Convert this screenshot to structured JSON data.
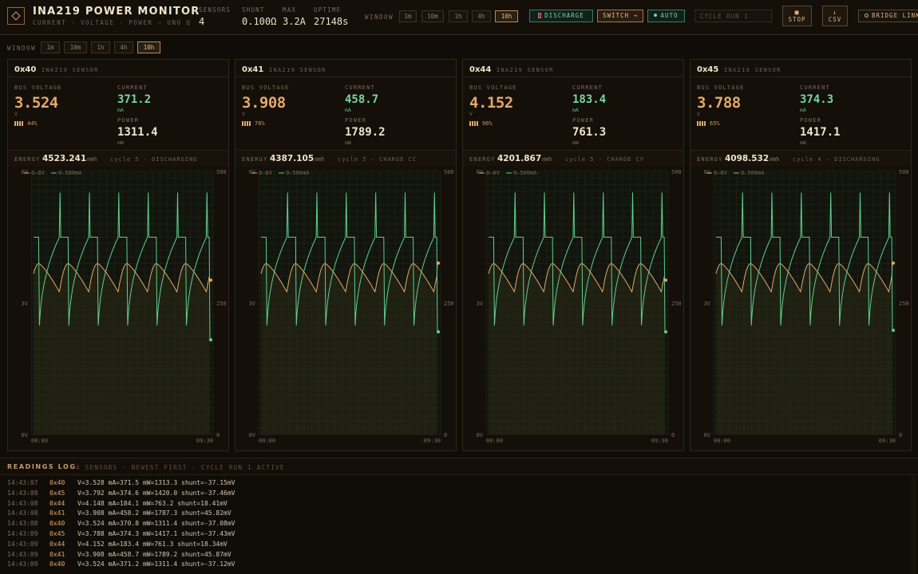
{
  "header": {
    "title": "INA219 POWER MONITOR",
    "subtitle": "CURRENT · VOLTAGE · POWER — UNO Q",
    "stats": [
      {
        "label": "SENSORS",
        "value": "4"
      },
      {
        "label": "SHUNT",
        "value": "0.100Ω"
      },
      {
        "label": "MAX",
        "value": "3.2A"
      },
      {
        "label": "UPTIME",
        "value": "27148s"
      }
    ],
    "window_label": "WINDOW",
    "windows": [
      "1m",
      "10m",
      "1h",
      "4h",
      "10h"
    ],
    "active_window": "10h",
    "discharge_label": "DISCHARGE",
    "switch_label": "SWITCH →",
    "auto_label": "AUTO",
    "cycle_placeholder": "CYCLE RUN 1",
    "stop_glyph": "■",
    "stop_label": "STOP",
    "csv_glyph": "↓",
    "csv_label": "CSV",
    "bridge_label": "BRIDGE LINK"
  },
  "subbar": {
    "window_label": "WINDOW",
    "windows": [
      "1m",
      "10m",
      "1h",
      "4h",
      "10h"
    ],
    "active_window": "10h"
  },
  "labels": {
    "bus_voltage": "BUS VOLTAGE",
    "current": "CURRENT",
    "power": "POWER",
    "unit_v": "V",
    "unit_ma": "mA",
    "unit_mw": "mW",
    "energy": "ENERGY",
    "energy_unit": "mWh",
    "sensor_type": "INA219 SENSOR",
    "legend_v": "0–6V",
    "legend_i": "0–500mA",
    "y_left": [
      "6V",
      "3V",
      "0V"
    ],
    "y_right": [
      "500",
      "250",
      "0"
    ],
    "x_ticks": [
      "00:00",
      "09:30"
    ]
  },
  "colors": {
    "voltage": "#e3a86a",
    "current": "#5fcf8f",
    "grid": "#1f2a1d"
  },
  "sensors": [
    {
      "address": "0x40",
      "voltage": "3.524",
      "current": "371.2",
      "power": "1311.4",
      "battery_pct": "44%",
      "battery_level": 0.44,
      "energy": "4523.241",
      "cycle": "cycle 5 · DISCHARGING"
    },
    {
      "address": "0x41",
      "voltage": "3.908",
      "current": "458.7",
      "power": "1789.2",
      "battery_pct": "76%",
      "battery_level": 0.76,
      "energy": "4387.105",
      "cycle": "cycle 5 · CHARGE CC"
    },
    {
      "address": "0x44",
      "voltage": "4.152",
      "current": "183.4",
      "power": "761.3",
      "battery_pct": "96%",
      "battery_level": 0.96,
      "energy": "4201.867",
      "cycle": "cycle 5 · CHARGE CV"
    },
    {
      "address": "0x45",
      "voltage": "3.788",
      "current": "374.3",
      "power": "1417.1",
      "battery_pct": "65%",
      "battery_level": 0.65,
      "energy": "4098.532",
      "cycle": "cycle 4 · DISCHARGING"
    }
  ],
  "chart_data": [
    {
      "type": "line",
      "sensor": "0x40",
      "x_range": [
        "00:00",
        "09:30"
      ],
      "voltage_range_v": [
        0,
        6
      ],
      "current_range_ma": [
        0,
        500
      ],
      "cycles": 6,
      "voltage_last": 3.52,
      "current_last": 180,
      "current_peak": 460,
      "current_plateau": 375,
      "voltage_peak": 3.9,
      "voltage_trough": 3.25,
      "current_trough": 140
    },
    {
      "type": "line",
      "sensor": "0x41",
      "x_range": [
        "00:00",
        "09:30"
      ],
      "voltage_range_v": [
        0,
        6
      ],
      "current_range_ma": [
        0,
        500
      ],
      "cycles": 6,
      "voltage_last": 3.91,
      "current_last": 195,
      "current_peak": 460,
      "current_plateau": 375,
      "voltage_peak": 3.9,
      "voltage_trough": 3.25,
      "current_trough": 140
    },
    {
      "type": "line",
      "sensor": "0x44",
      "x_range": [
        "00:00",
        "09:30"
      ],
      "voltage_range_v": [
        0,
        6
      ],
      "current_range_ma": [
        0,
        500
      ],
      "cycles": 6,
      "voltage_last": 3.52,
      "current_last": 195,
      "current_peak": 460,
      "current_plateau": 375,
      "voltage_peak": 3.9,
      "voltage_trough": 3.25,
      "current_trough": 140
    },
    {
      "type": "line",
      "sensor": "0x45",
      "x_range": [
        "00:00",
        "09:30"
      ],
      "voltage_range_v": [
        0,
        6
      ],
      "current_range_ma": [
        0,
        500
      ],
      "cycles": 6,
      "voltage_last": 3.91,
      "current_last": 198,
      "current_peak": 460,
      "current_plateau": 375,
      "voltage_peak": 3.9,
      "voltage_trough": 3.25,
      "current_trough": 140
    }
  ],
  "log": {
    "title": "READINGS LOG",
    "subtitle": "4 SENSORS · NEWEST FIRST · CYCLE RUN 1 ACTIVE",
    "rows": [
      {
        "time": "14:43:07",
        "addr": "0x40",
        "data": "V=3.528 mA=371.5 mW=1313.3 shunt=-37.15mV"
      },
      {
        "time": "14:43:08",
        "addr": "0x45",
        "data": "V=3.792 mA=374.6 mW=1420.0 shunt=-37.46mV"
      },
      {
        "time": "14:43:08",
        "addr": "0x44",
        "data": "V=4.148 mA=184.1 mW=763.2 shunt=18.41mV"
      },
      {
        "time": "14:43:08",
        "addr": "0x41",
        "data": "V=3.908 mA=458.2 mW=1787.3 shunt=45.82mV"
      },
      {
        "time": "14:43:08",
        "addr": "0x40",
        "data": "V=3.524 mA=370.8 mW=1311.4 shunt=-37.08mV"
      },
      {
        "time": "14:43:09",
        "addr": "0x45",
        "data": "V=3.788 mA=374.3 mW=1417.1 shunt=-37.43mV"
      },
      {
        "time": "14:43:09",
        "addr": "0x44",
        "data": "V=4.152 mA=183.4 mW=761.3 shunt=18.34mV"
      },
      {
        "time": "14:43:09",
        "addr": "0x41",
        "data": "V=3.908 mA=458.7 mW=1789.2 shunt=45.87mV"
      },
      {
        "time": "14:43:09",
        "addr": "0x40",
        "data": "V=3.524 mA=371.2 mW=1311.4 shunt=-37.12mV"
      }
    ]
  }
}
